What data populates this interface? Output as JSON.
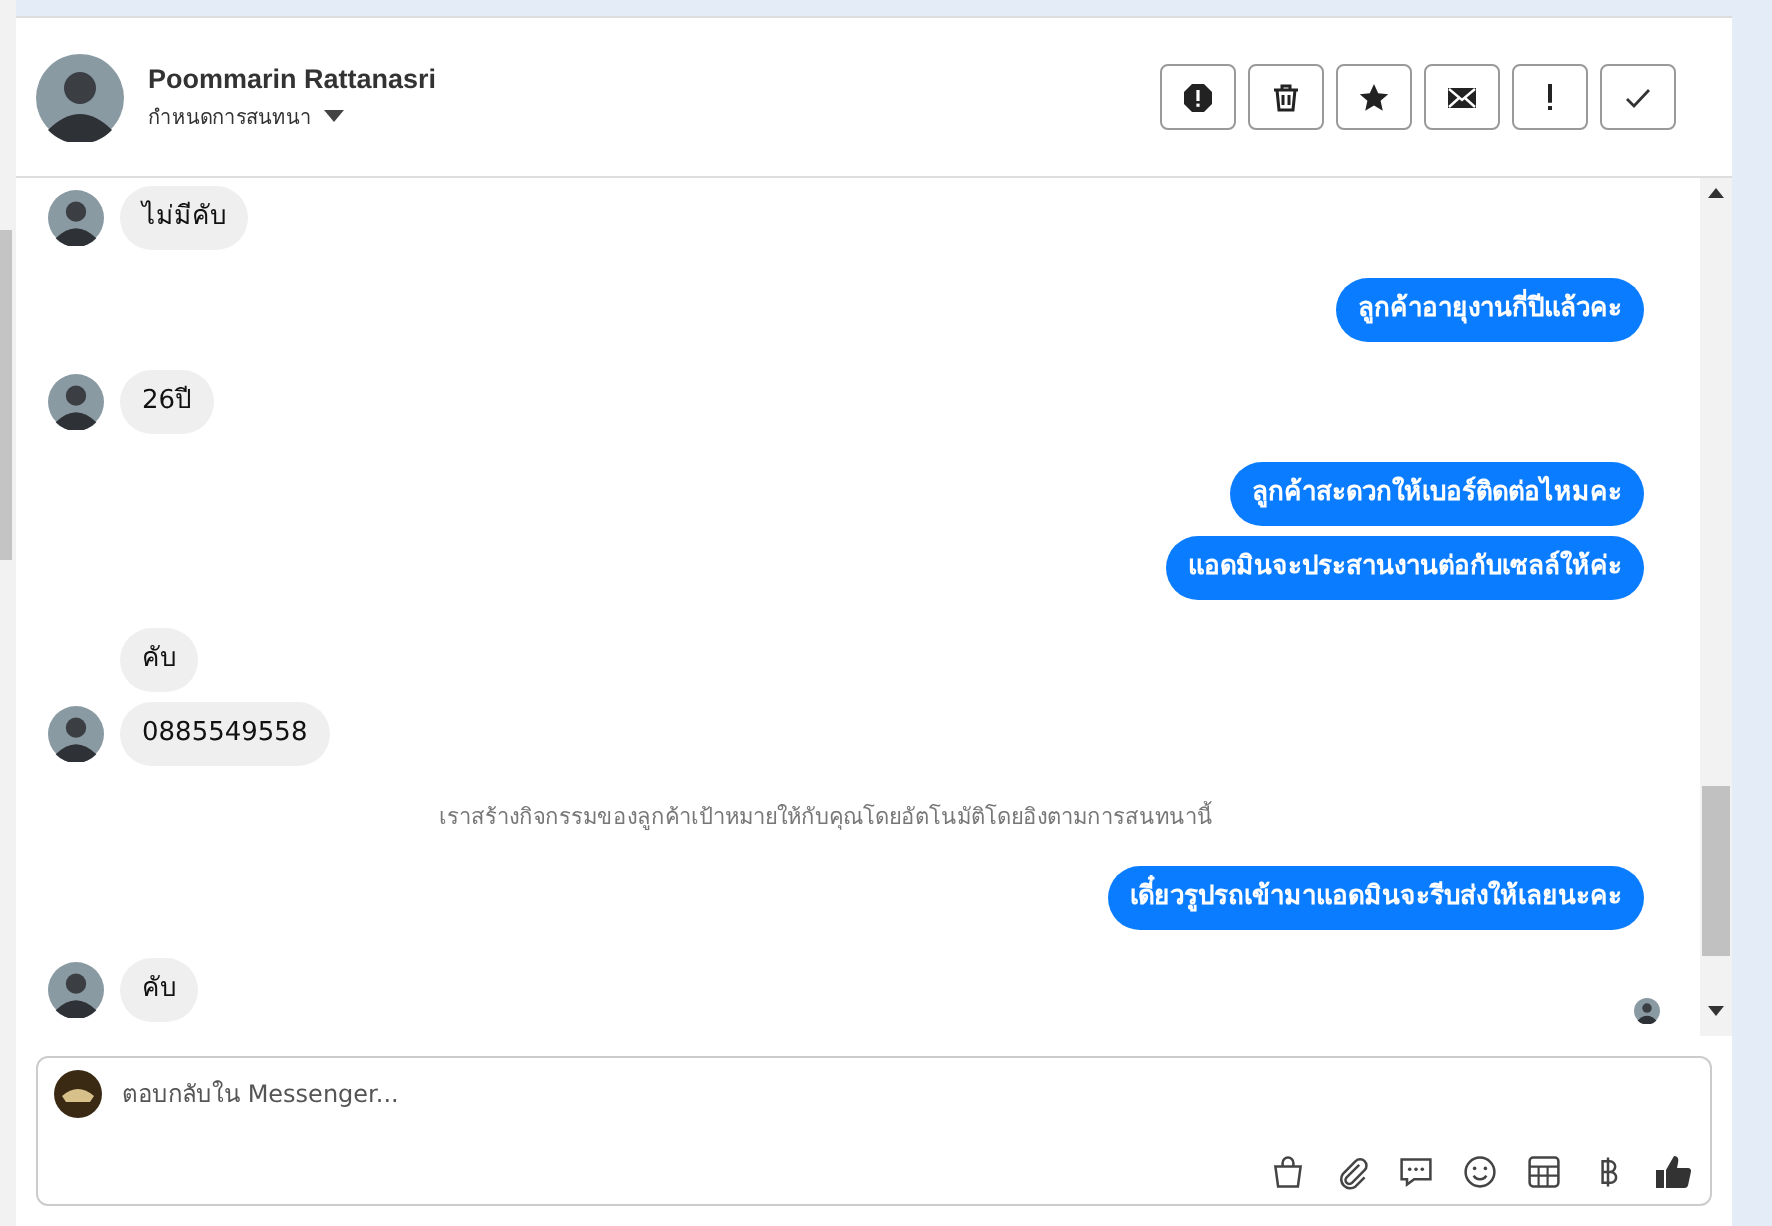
{
  "header": {
    "name": "Poommarin Rattanasri",
    "subtitle": "กำหนดการสนทนา"
  },
  "messages": [
    {
      "kind": "incoming",
      "text": "ไม่มีคับ",
      "avatar": true
    },
    {
      "kind": "outgoing",
      "text": "ลูกค้าอายุงานกี่ปีแล้วคะ"
    },
    {
      "kind": "incoming",
      "text": "26ปี",
      "avatar": true
    },
    {
      "kind": "outgoing",
      "text": "ลูกค้าสะดวกให้เบอร์ติดต่อไหมคะ"
    },
    {
      "kind": "outgoing",
      "text": "แอดมินจะประสานงานต่อกับเซลล์ให้ค่ะ"
    },
    {
      "kind": "incoming",
      "text": "คับ",
      "avatar": false
    },
    {
      "kind": "incoming",
      "text": "0885549558",
      "avatar": true
    },
    {
      "kind": "system",
      "text": "เราสร้างกิจกรรมของลูกค้าเป้าหมายให้กับคุณโดยอัตโนมัติโดยอิงตามการสนทนานี้"
    },
    {
      "kind": "outgoing",
      "text": "เดี๋ยวรูปรถเข้ามาแอดมินจะรีบส่งให้เลยนะคะ"
    },
    {
      "kind": "incoming",
      "text": "คับ",
      "avatar": true
    }
  ],
  "composer": {
    "placeholder": "ตอบกลับใน Messenger..."
  }
}
